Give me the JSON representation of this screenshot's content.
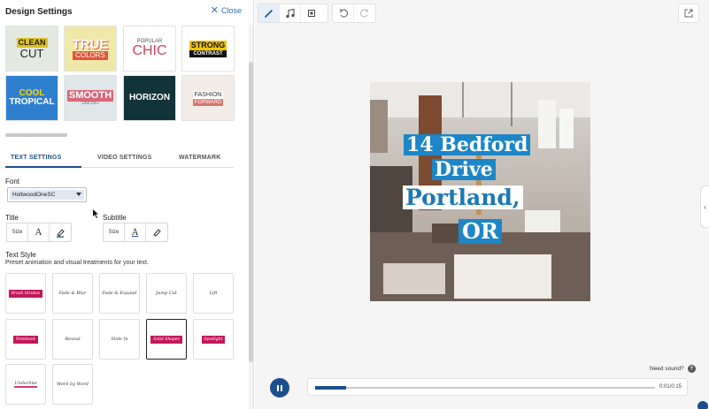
{
  "panel": {
    "title": "Design Settings",
    "close_label": "Close",
    "themes": [
      {
        "id": "clean-cut",
        "line1": "CLEAN",
        "line2": "CUT",
        "bg": "#e4e9e2",
        "fg": "#1a1a1a",
        "accent": "#e0c21e"
      },
      {
        "id": "true-colors",
        "line1": "TRUE",
        "line2": "COLORS",
        "bg": "#f0e8a8",
        "fg": "#ffffff",
        "accent": "#e0553a"
      },
      {
        "id": "popular-chic",
        "line1": "POPULAR",
        "line2": "CHIC",
        "bg": "#ffffff",
        "fg": "#c9455a",
        "accent": "#555555"
      },
      {
        "id": "strong-contrast",
        "line1": "STRONG",
        "line2": "CONTRAST",
        "bg": "#ffffff",
        "fg": "#111111",
        "accent": "#f2c500"
      },
      {
        "id": "cool-tropical",
        "line1": "COOL",
        "line2": "TROPICAL",
        "bg": "#2f7fcf",
        "fg": "#ffffff",
        "accent": "#f7d800"
      },
      {
        "id": "smooth-sailing",
        "line1": "SMOOTH",
        "line2": "SAILING",
        "bg": "#dfe7e9",
        "fg": "#ffffff",
        "accent": "#d9667a"
      },
      {
        "id": "horizon",
        "line1": "HORIZON",
        "line2": "",
        "bg": "#12333a",
        "fg": "#ffffff",
        "accent": "#ffffff"
      },
      {
        "id": "fashion-forward",
        "line1": "FASHION",
        "line2": "FORWARD",
        "bg": "#f2ece8",
        "fg": "#ffffff",
        "accent": "#d9756a"
      }
    ],
    "tabs": [
      "TEXT SETTINGS",
      "VIDEO SETTINGS",
      "WATERMARK"
    ],
    "font_label": "Font",
    "font_value": "HoltwoodOneSC",
    "title_label": "Title",
    "subtitle_label": "Subtitle",
    "size_label": "Size",
    "text_style_label": "Text Style",
    "text_style_desc": "Preset animation and visual treatments for your text.",
    "styles": [
      {
        "label": "Brush Strokes",
        "kind": "pink"
      },
      {
        "label": "Fade & Blur",
        "kind": "script"
      },
      {
        "label": "Fade & Expand",
        "kind": "script"
      },
      {
        "label": "Jump Cut",
        "kind": "script"
      },
      {
        "label": "Lift",
        "kind": "script"
      },
      {
        "label": "Notebook",
        "kind": "pink"
      },
      {
        "label": "Reveal",
        "kind": "script"
      },
      {
        "label": "Slide In",
        "kind": "script"
      },
      {
        "label": "Solid Shapes",
        "kind": "pink"
      },
      {
        "label": "Spotlight",
        "kind": "pink"
      },
      {
        "label": "Underline",
        "kind": "underline"
      },
      {
        "label": "Word by Word",
        "kind": "script"
      }
    ],
    "selected_style": "Solid Shapes"
  },
  "toolbar": {
    "tools": [
      "pencil-icon",
      "music-note-icon",
      "resize-icon"
    ],
    "history": [
      "undo-icon",
      "redo-icon"
    ],
    "export": "external-link-icon"
  },
  "preview": {
    "caption_lines": [
      "14 Bedford",
      "Drive",
      "Portland,",
      "OR"
    ]
  },
  "player": {
    "need_sound": "Need sound?",
    "timecode": "0:01/0:15",
    "progress": 0.09
  },
  "colors": {
    "accent": "#1c4f8f",
    "link": "#2c6fb7",
    "caption_blue": "#1e86c6"
  }
}
